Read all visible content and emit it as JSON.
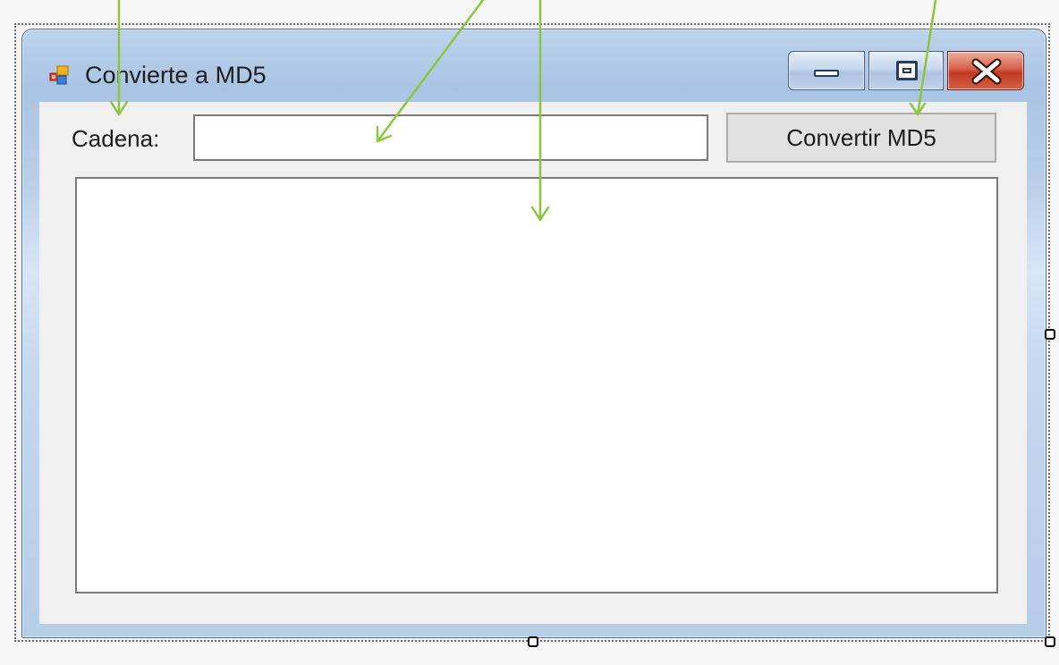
{
  "window": {
    "title": "Convierte a MD5"
  },
  "form": {
    "cadena_label": "Cadena:",
    "cadena_value": "",
    "convert_button_label": "Convertir MD5",
    "output_value": ""
  },
  "icons": {
    "app_icon": "windows-form-icon",
    "minimize": "minimize-icon",
    "maximize": "maximize-icon",
    "close": "close-icon"
  },
  "colors": {
    "annotation_arrow": "#8cc63f",
    "close_button": "#c7452d",
    "frame": "#b9cfe8",
    "client_background": "#f0f0f0"
  }
}
